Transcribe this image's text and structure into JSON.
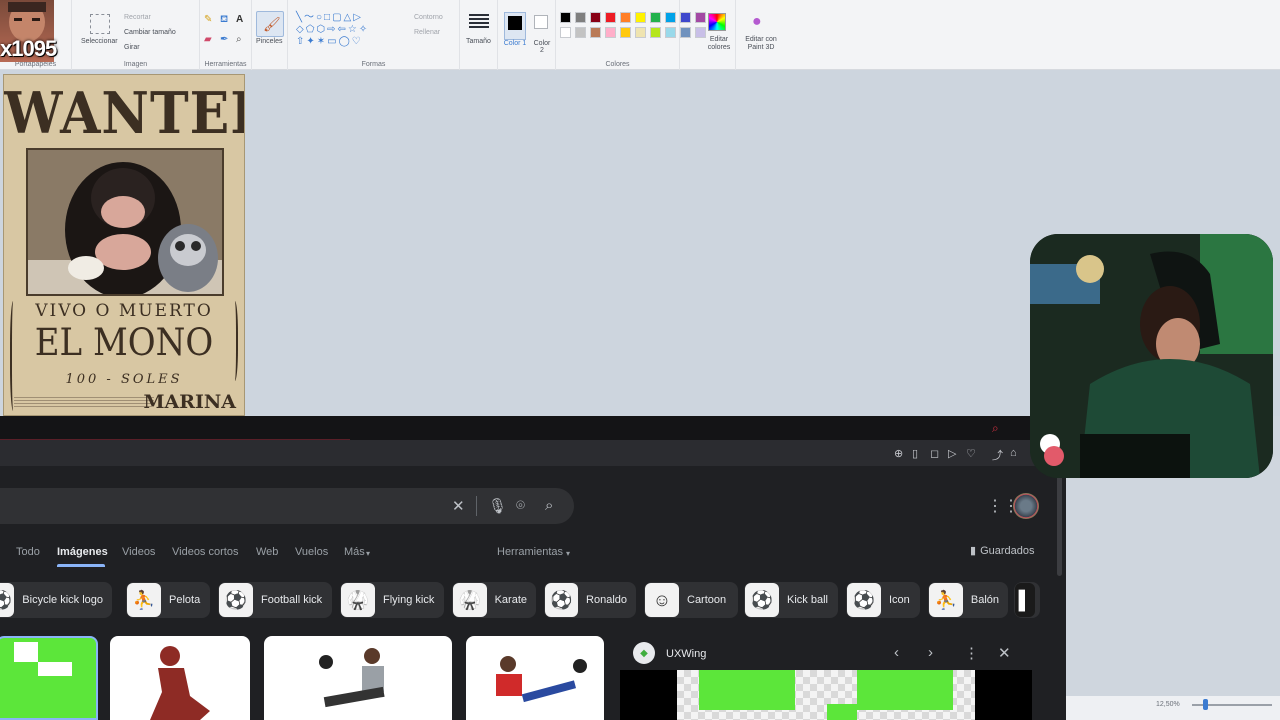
{
  "paint": {
    "clipboard_label": "Portapapeles",
    "select_label": "Seleccionar",
    "crop_label": "Recortar",
    "resize_label": "Cambiar tamaño",
    "rotate_label": "Girar",
    "image_label": "Imagen",
    "tools_label": "Herramientas",
    "brushes_label": "Pinceles",
    "shapes_label": "Formas",
    "outline_label": "Contorno",
    "fill_label": "Rellenar",
    "size_label": "Tamaño",
    "color1_label": "Color 1",
    "color2_label": "Color 2",
    "colors_label": "Colores",
    "edit_colors_label": "Editar colores",
    "paint3d_label": "Editar con Paint 3D",
    "palette": [
      "#000000",
      "#7f7f7f",
      "#880015",
      "#ed1c24",
      "#ff7f27",
      "#fff200",
      "#22b14c",
      "#00a2e8",
      "#3f48cc",
      "#a349a4",
      "#ffffff",
      "#c3c3c3",
      "#b97a57",
      "#ffaec9",
      "#ffc90e",
      "#efe4b0",
      "#b5e61d",
      "#99d9ea",
      "#7092be",
      "#c8bfe7"
    ],
    "zoom": "12,50%"
  },
  "poster": {
    "title": "WANTED",
    "subtitle": "VIVO O MUERTO",
    "name": "EL MONO",
    "reward": "100 - SOLES",
    "org": "MARINA"
  },
  "overlay": {
    "tag": "x1095"
  },
  "browser": {
    "tabs": [
      "Todo",
      "Imágenes",
      "Videos",
      "Videos cortos",
      "Web",
      "Vuelos",
      "Más"
    ],
    "tools": "Herramientas",
    "saved": "Guardados",
    "chips": [
      "Bicycle kick logo",
      "Pelota",
      "Football kick",
      "Flying kick",
      "Karate",
      "Ronaldo",
      "Cartoon",
      "Kick ball",
      "Icon",
      "Balón"
    ],
    "side_panel_title": "UXWing"
  }
}
